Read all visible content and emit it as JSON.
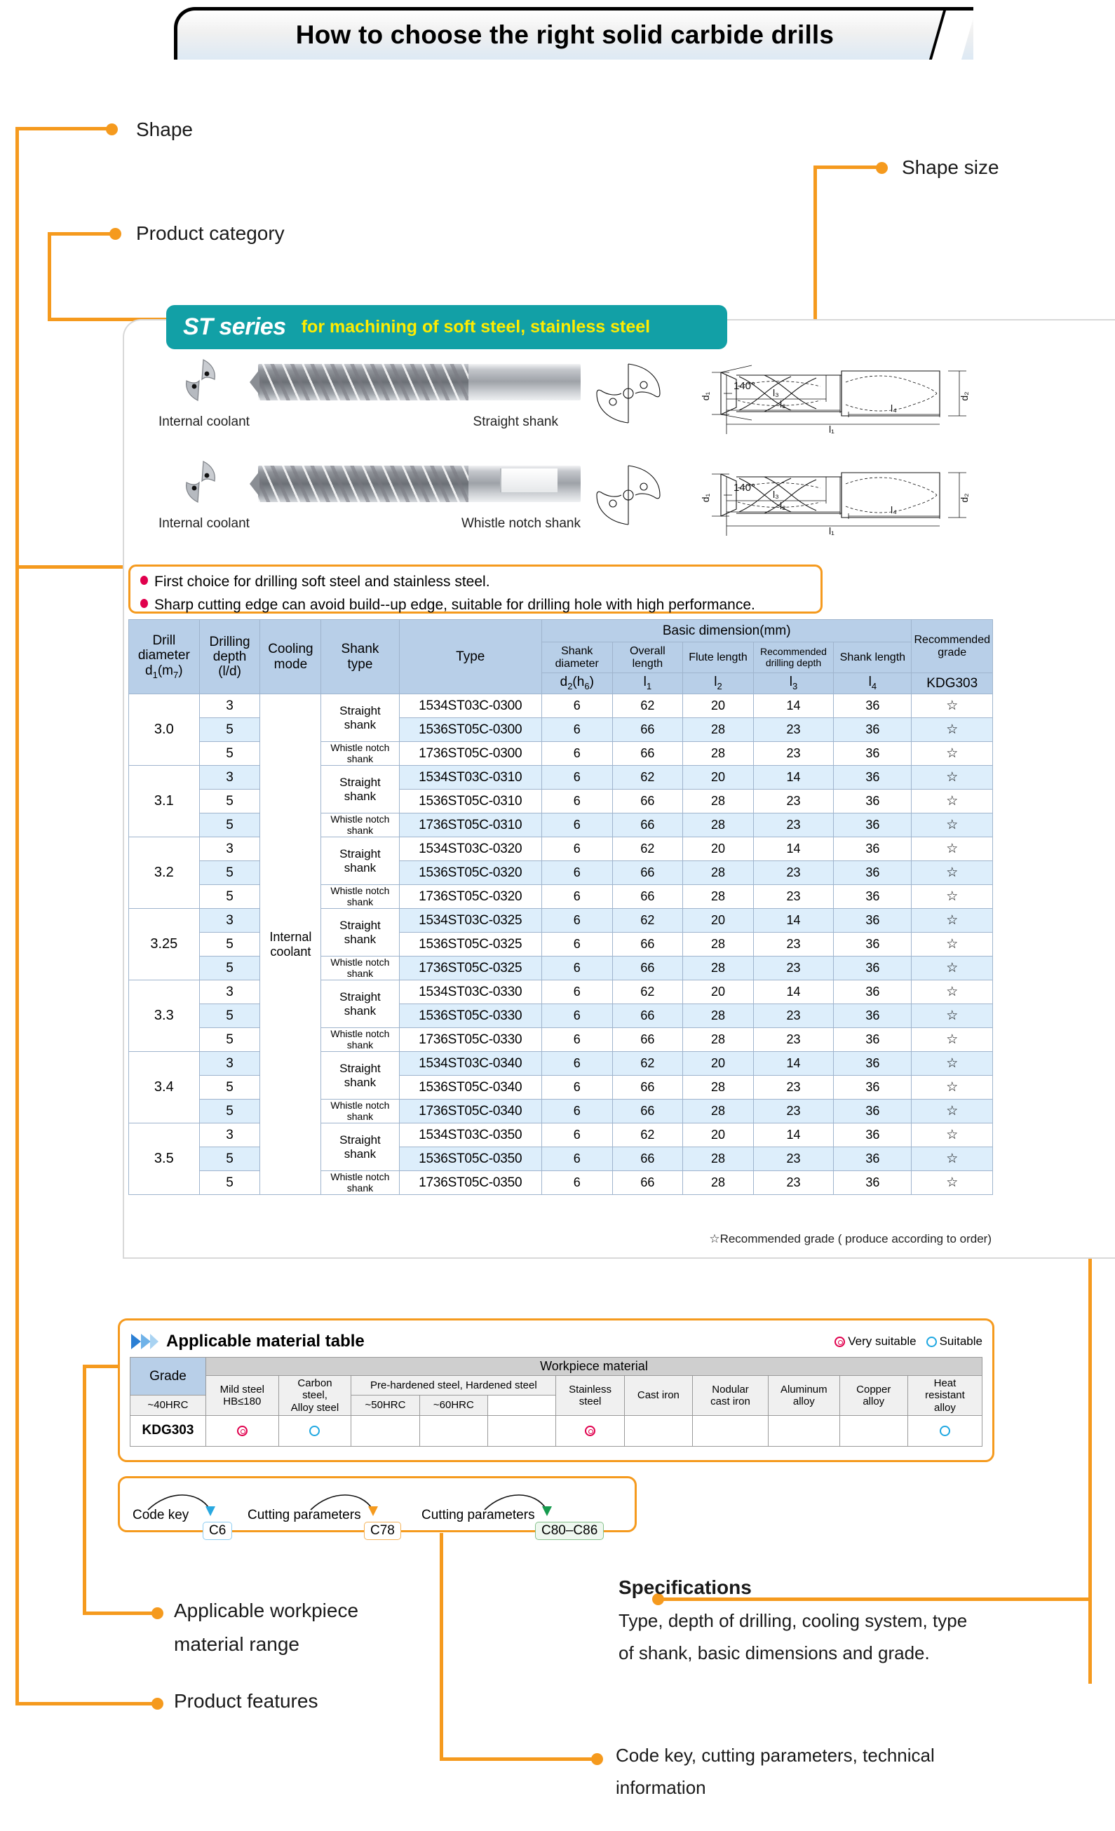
{
  "page": {
    "title": "How to choose the right solid carbide drills"
  },
  "callouts": {
    "shape": "Shape",
    "product_category": "Product category",
    "shape_size": "Shape size",
    "applicable_material_range": "Applicable workpiece\nmaterial range",
    "applicable_material_range_l1": "Applicable workpiece",
    "applicable_material_range_l2": "material range",
    "product_features": "Product features",
    "specifications_title": "Specifications",
    "specifications_l1": "Type, depth of drilling, cooling system, type",
    "specifications_l2": "of shank, basic dimensions and grade.",
    "codekey_l1": "Code key, cutting parameters, technical",
    "codekey_l2": "information"
  },
  "series": {
    "name": "ST series",
    "description": "for machining of soft steel, stainless steel",
    "banner_color": "#12a0a6",
    "name_color": "#ffffff",
    "description_color": "#ffec00"
  },
  "products": [
    {
      "coolant_label": "Internal coolant",
      "shank_label": "Straight shank"
    },
    {
      "coolant_label": "Internal coolant",
      "shank_label": "Whistle notch shank"
    }
  ],
  "drawing": {
    "d1": "d1",
    "d2": "d2",
    "angle": "140°",
    "l1": "l1",
    "l2": "l2",
    "l3": "l3",
    "l4": "l4"
  },
  "features": [
    "First choice for drilling soft steel and stainless steel.",
    "Sharp cutting edge can avoid build--up edge, suitable for drilling hole with high performance."
  ],
  "spec_table": {
    "group_header": "Basic dimension(mm)",
    "headers": {
      "drill_diameter": "Drill\ndiameter",
      "drill_diameter_l1": "Drill",
      "drill_diameter_l2": "diameter",
      "drill_diameter_sym": "d1(m7)",
      "drilling_depth_l1": "Drilling",
      "drilling_depth_l2": "depth",
      "drilling_depth_sym": "(l/d)",
      "cooling_mode_l1": "Cooling",
      "cooling_mode_l2": "mode",
      "shank_type_l1": "Shank",
      "shank_type_l2": "type",
      "type": "Type",
      "shank_diameter_l1": "Shank",
      "shank_diameter_l2": "diameter",
      "overall_length_l1": "Overall",
      "overall_length_l2": "length",
      "flute_length": "Flute length",
      "recommended_drilling_depth_l1": "Recommended",
      "recommended_drilling_depth_l2": "drilling depth",
      "shank_length": "Shank length",
      "recommended_grade_l1": "Recommended",
      "recommended_grade_l2": "grade"
    },
    "symbols": {
      "shank_diameter": "d2(h6)",
      "overall_length": "l1",
      "flute_length": "l2",
      "recommended_drilling_depth": "l3",
      "shank_length": "l4",
      "grade": "KDG303"
    },
    "cooling_mode_value_l1": "Internal",
    "cooling_mode_value_l2": "coolant",
    "shank_types": {
      "straight_l1": "Straight",
      "straight_l2": "shank",
      "whistle_l1": "Whistle notch",
      "whistle_l2": "shank"
    },
    "groups": [
      {
        "diameter": "3.0",
        "rows": [
          {
            "depth": "3",
            "shank": "straight",
            "type": "1534ST03C-0300",
            "d2": "6",
            "l1": "62",
            "l2": "20",
            "l3": "14",
            "l4": "36",
            "grade": "☆",
            "shade": "A"
          },
          {
            "depth": "5",
            "shank": "straight",
            "type": "1536ST05C-0300",
            "d2": "6",
            "l1": "66",
            "l2": "28",
            "l3": "23",
            "l4": "36",
            "grade": "☆",
            "shade": "B"
          },
          {
            "depth": "5",
            "shank": "whistle",
            "type": "1736ST05C-0300",
            "d2": "6",
            "l1": "66",
            "l2": "28",
            "l3": "23",
            "l4": "36",
            "grade": "☆",
            "shade": "A"
          }
        ]
      },
      {
        "diameter": "3.1",
        "rows": [
          {
            "depth": "3",
            "shank": "straight",
            "type": "1534ST03C-0310",
            "d2": "6",
            "l1": "62",
            "l2": "20",
            "l3": "14",
            "l4": "36",
            "grade": "☆",
            "shade": "B"
          },
          {
            "depth": "5",
            "shank": "straight",
            "type": "1536ST05C-0310",
            "d2": "6",
            "l1": "66",
            "l2": "28",
            "l3": "23",
            "l4": "36",
            "grade": "☆",
            "shade": "A"
          },
          {
            "depth": "5",
            "shank": "whistle",
            "type": "1736ST05C-0310",
            "d2": "6",
            "l1": "66",
            "l2": "28",
            "l3": "23",
            "l4": "36",
            "grade": "☆",
            "shade": "B"
          }
        ]
      },
      {
        "diameter": "3.2",
        "rows": [
          {
            "depth": "3",
            "shank": "straight",
            "type": "1534ST03C-0320",
            "d2": "6",
            "l1": "62",
            "l2": "20",
            "l3": "14",
            "l4": "36",
            "grade": "☆",
            "shade": "A"
          },
          {
            "depth": "5",
            "shank": "straight",
            "type": "1536ST05C-0320",
            "d2": "6",
            "l1": "66",
            "l2": "28",
            "l3": "23",
            "l4": "36",
            "grade": "☆",
            "shade": "B"
          },
          {
            "depth": "5",
            "shank": "whistle",
            "type": "1736ST05C-0320",
            "d2": "6",
            "l1": "66",
            "l2": "28",
            "l3": "23",
            "l4": "36",
            "grade": "☆",
            "shade": "A"
          }
        ]
      },
      {
        "diameter": "3.25",
        "rows": [
          {
            "depth": "3",
            "shank": "straight",
            "type": "1534ST03C-0325",
            "d2": "6",
            "l1": "62",
            "l2": "20",
            "l3": "14",
            "l4": "36",
            "grade": "☆",
            "shade": "B"
          },
          {
            "depth": "5",
            "shank": "straight",
            "type": "1536ST05C-0325",
            "d2": "6",
            "l1": "66",
            "l2": "28",
            "l3": "23",
            "l4": "36",
            "grade": "☆",
            "shade": "A"
          },
          {
            "depth": "5",
            "shank": "whistle",
            "type": "1736ST05C-0325",
            "d2": "6",
            "l1": "66",
            "l2": "28",
            "l3": "23",
            "l4": "36",
            "grade": "☆",
            "shade": "B"
          }
        ]
      },
      {
        "diameter": "3.3",
        "rows": [
          {
            "depth": "3",
            "shank": "straight",
            "type": "1534ST03C-0330",
            "d2": "6",
            "l1": "62",
            "l2": "20",
            "l3": "14",
            "l4": "36",
            "grade": "☆",
            "shade": "A"
          },
          {
            "depth": "5",
            "shank": "straight",
            "type": "1536ST05C-0330",
            "d2": "6",
            "l1": "66",
            "l2": "28",
            "l3": "23",
            "l4": "36",
            "grade": "☆",
            "shade": "B"
          },
          {
            "depth": "5",
            "shank": "whistle",
            "type": "1736ST05C-0330",
            "d2": "6",
            "l1": "66",
            "l2": "28",
            "l3": "23",
            "l4": "36",
            "grade": "☆",
            "shade": "A"
          }
        ]
      },
      {
        "diameter": "3.4",
        "rows": [
          {
            "depth": "3",
            "shank": "straight",
            "type": "1534ST03C-0340",
            "d2": "6",
            "l1": "62",
            "l2": "20",
            "l3": "14",
            "l4": "36",
            "grade": "☆",
            "shade": "B"
          },
          {
            "depth": "5",
            "shank": "straight",
            "type": "1536ST05C-0340",
            "d2": "6",
            "l1": "66",
            "l2": "28",
            "l3": "23",
            "l4": "36",
            "grade": "☆",
            "shade": "A"
          },
          {
            "depth": "5",
            "shank": "whistle",
            "type": "1736ST05C-0340",
            "d2": "6",
            "l1": "66",
            "l2": "28",
            "l3": "23",
            "l4": "36",
            "grade": "☆",
            "shade": "B"
          }
        ]
      },
      {
        "diameter": "3.5",
        "rows": [
          {
            "depth": "3",
            "shank": "straight",
            "type": "1534ST03C-0350",
            "d2": "6",
            "l1": "62",
            "l2": "20",
            "l3": "14",
            "l4": "36",
            "grade": "☆",
            "shade": "A"
          },
          {
            "depth": "5",
            "shank": "straight",
            "type": "1536ST05C-0350",
            "d2": "6",
            "l1": "66",
            "l2": "28",
            "l3": "23",
            "l4": "36",
            "grade": "☆",
            "shade": "B"
          },
          {
            "depth": "5",
            "shank": "whistle",
            "type": "1736ST05C-0350",
            "d2": "6",
            "l1": "66",
            "l2": "28",
            "l3": "23",
            "l4": "36",
            "grade": "☆",
            "shade": "A"
          }
        ]
      }
    ],
    "note": "☆Recommended grade ( produce according to order)"
  },
  "material_table": {
    "title": "Applicable material table",
    "legend": {
      "very_suitable": "Very suitable",
      "suitable": "Suitable"
    },
    "grade_header": "Grade",
    "workpiece_header": "Workpiece material",
    "columns": [
      {
        "l1": "Mild steel",
        "l2": "HB≤180",
        "span": 1
      },
      {
        "l1": "Carbon",
        "l2": "steel,",
        "l3": "Alloy steel",
        "span": 1
      },
      {
        "l1": "~40HRC",
        "span": 1
      },
      {
        "l1": "~50HRC",
        "span": 1
      },
      {
        "l1": "~60HRC",
        "span": 1
      },
      {
        "l1": "Stainless",
        "l2": "steel",
        "span": 1
      },
      {
        "l1": "Cast iron",
        "span": 1
      },
      {
        "l1": "Nodular",
        "l2": "cast iron",
        "span": 1
      },
      {
        "l1": "Aluminum",
        "l2": "alloy",
        "span": 1
      },
      {
        "l1": "Copper",
        "l2": "alloy",
        "span": 1
      },
      {
        "l1": "Heat",
        "l2": "resistant",
        "l3": "alloy",
        "span": 1
      }
    ],
    "prehardened_header": "Pre-hardened steel, Hardened steel",
    "rows": [
      {
        "grade": "KDG303",
        "values": [
          "very",
          "suitable",
          "",
          "",
          "",
          "very",
          "",
          "",
          "",
          "",
          "suitable"
        ]
      }
    ]
  },
  "code_key": {
    "items": [
      {
        "label": "Code key",
        "tag": "C6",
        "color": "blue"
      },
      {
        "label": "Cutting parameters",
        "tag": "C78",
        "color": "orange"
      },
      {
        "label": "Cutting parameters",
        "tag": "C80–C86",
        "color": "green"
      }
    ]
  },
  "colors": {
    "accent_orange": "#f59a1e",
    "teal": "#12a0a6",
    "table_header_blue": "#b8cfe8",
    "row_shade_blue": "#ddeefb",
    "red": "#e0004d",
    "cyan": "#1ea7e1"
  }
}
